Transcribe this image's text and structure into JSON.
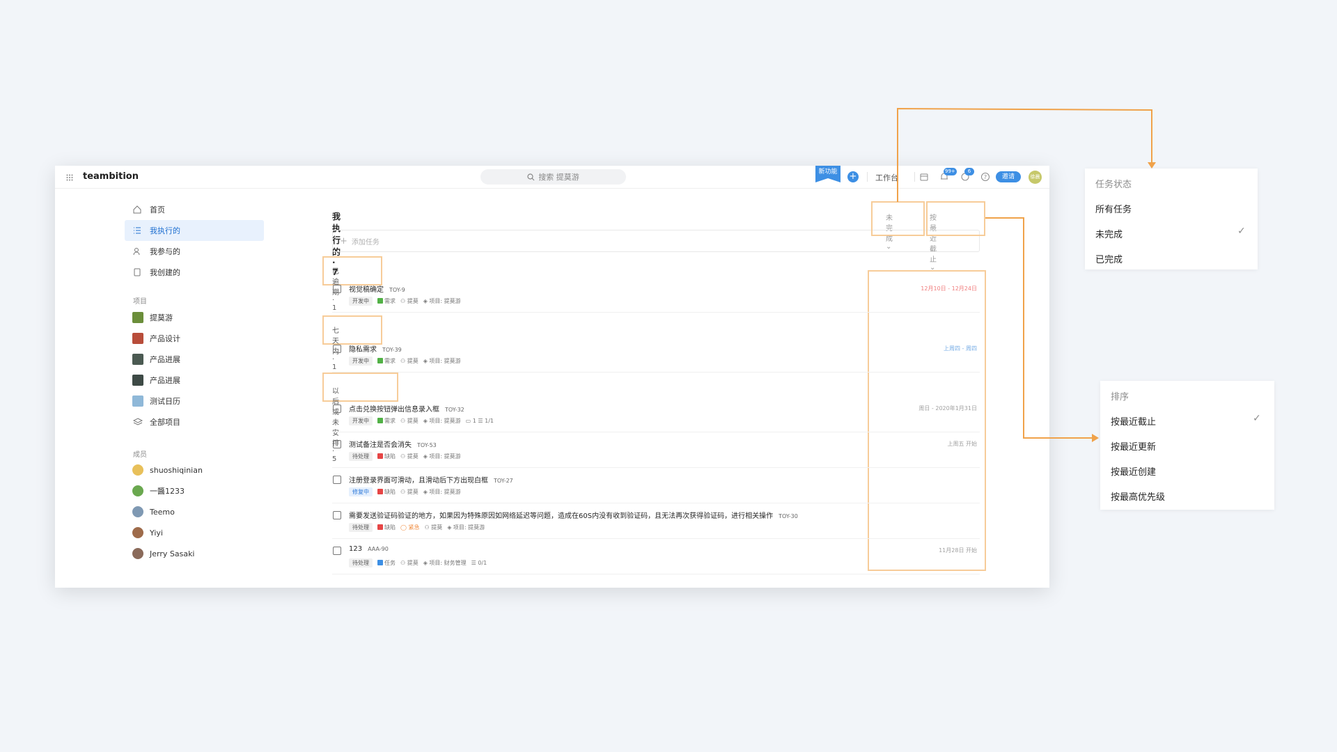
{
  "app": {
    "brand": "teambition",
    "search_placeholder": "搜索 提莫游",
    "new_feature_label": "新功能",
    "workbench_label": "工作台",
    "notifications_badge": "99+",
    "messages_badge": "6",
    "invite_label": "邀请",
    "avatar_text": "徐晨"
  },
  "sidebar": {
    "nav": [
      {
        "label": "首页",
        "icon": "home-icon"
      },
      {
        "label": "我执行的",
        "icon": "list-icon"
      },
      {
        "label": "我参与的",
        "icon": "people-icon"
      },
      {
        "label": "我创建的",
        "icon": "clipboard-icon"
      }
    ],
    "projects_heading": "项目",
    "projects": [
      {
        "label": "提莫游",
        "color": "#6b8e3a"
      },
      {
        "label": "产品设计",
        "color": "#b84d3a"
      },
      {
        "label": "产品进展",
        "color": "#4b5a52"
      },
      {
        "label": "产品进展",
        "color": "#3e4a46"
      },
      {
        "label": "测试日历",
        "color": "#8fb8d8"
      },
      {
        "label": "全部项目",
        "color": ""
      }
    ],
    "members_heading": "成员",
    "members": [
      {
        "label": "shuoshiqinian",
        "color": "#e8c05a"
      },
      {
        "label": "一醬1233",
        "color": "#6aa84f"
      },
      {
        "label": "Teemo",
        "color": "#7f99b3"
      },
      {
        "label": "Yiyi",
        "color": "#9e6b4a"
      },
      {
        "label": "Jerry Sasaki",
        "color": "#8a6a5a"
      }
    ]
  },
  "main": {
    "title": "我执行的 · 7",
    "filter_status": "未完成 ⌄",
    "filter_sort": "按最近截止 ⌄",
    "add_task": "添加任务",
    "groups": [
      {
        "label": "已逾期 · 1"
      },
      {
        "label": "七天内 · 1"
      },
      {
        "label": "以后或未安排 · 5"
      }
    ],
    "tasks": [
      {
        "title": "视觉稿确定",
        "id": "TOY-9",
        "status": "开发中",
        "type": "需求",
        "type_color": "#52b146",
        "assignee": "提莫",
        "project": "项目: 提莫游",
        "extra": "",
        "date": "12月10日 - 12月24日"
      },
      {
        "title": "隐私需求",
        "id": "TOY-39",
        "status": "开发中",
        "type": "需求",
        "type_color": "#52b146",
        "assignee": "提莫",
        "project": "项目: 提莫游",
        "extra": "",
        "date": "上周四 - 周四"
      },
      {
        "title": "点击兑换按钮弹出信息录入框",
        "id": "TOY-32",
        "status": "开发中",
        "type": "需求",
        "type_color": "#52b146",
        "assignee": "提莫",
        "project": "项目: 提莫游",
        "extra": "▭ 1   ☰ 1/1",
        "date": "周日 - 2020年1月31日"
      },
      {
        "title": "测试备注是否会消失",
        "id": "TOY-53",
        "status": "待处理",
        "type": "缺陷",
        "type_color": "#e64545",
        "assignee": "提莫",
        "project": "项目: 提莫游",
        "extra": "",
        "date": "上周五 开始"
      },
      {
        "title": "注册登录界面可滑动，且滑动后下方出现白框",
        "id": "TOY-27",
        "status": "修复中",
        "type": "缺陷",
        "type_color": "#e64545",
        "assignee": "提莫",
        "project": "项目: 提莫游",
        "extra": "",
        "date": ""
      },
      {
        "title": "需要发送验证码验证的地方，如果因为特殊原因如网络延迟等问题，造成在60S内没有收到验证码，且无法再次获得验证码，进行相关操作",
        "id": "TOY-30",
        "status": "待处理",
        "type": "缺陷",
        "type_color": "#e64545",
        "priority": "紧急",
        "assignee": "提莫",
        "project": "项目: 提莫游",
        "extra": "",
        "date": ""
      },
      {
        "title": "123",
        "id": "AAA-90",
        "status": "待处理",
        "type": "任务",
        "type_color": "#3d8fe4",
        "assignee": "提莫",
        "project": "项目: 财务管理",
        "extra": "☰ 0/1",
        "date": "11月28日 开始"
      }
    ]
  },
  "status_menu": {
    "heading": "任务状态",
    "items": [
      "所有任务",
      "未完成",
      "已完成"
    ],
    "checked": "未完成"
  },
  "sort_menu": {
    "heading": "排序",
    "items": [
      "按最近截止",
      "按最近更新",
      "按最近创建",
      "按最高优先级"
    ],
    "checked": "按最近截止"
  },
  "colors": {
    "accent": "#3d8fe4",
    "annotation_line": "#f0a24a",
    "annotation_box": "#f7cc99"
  }
}
